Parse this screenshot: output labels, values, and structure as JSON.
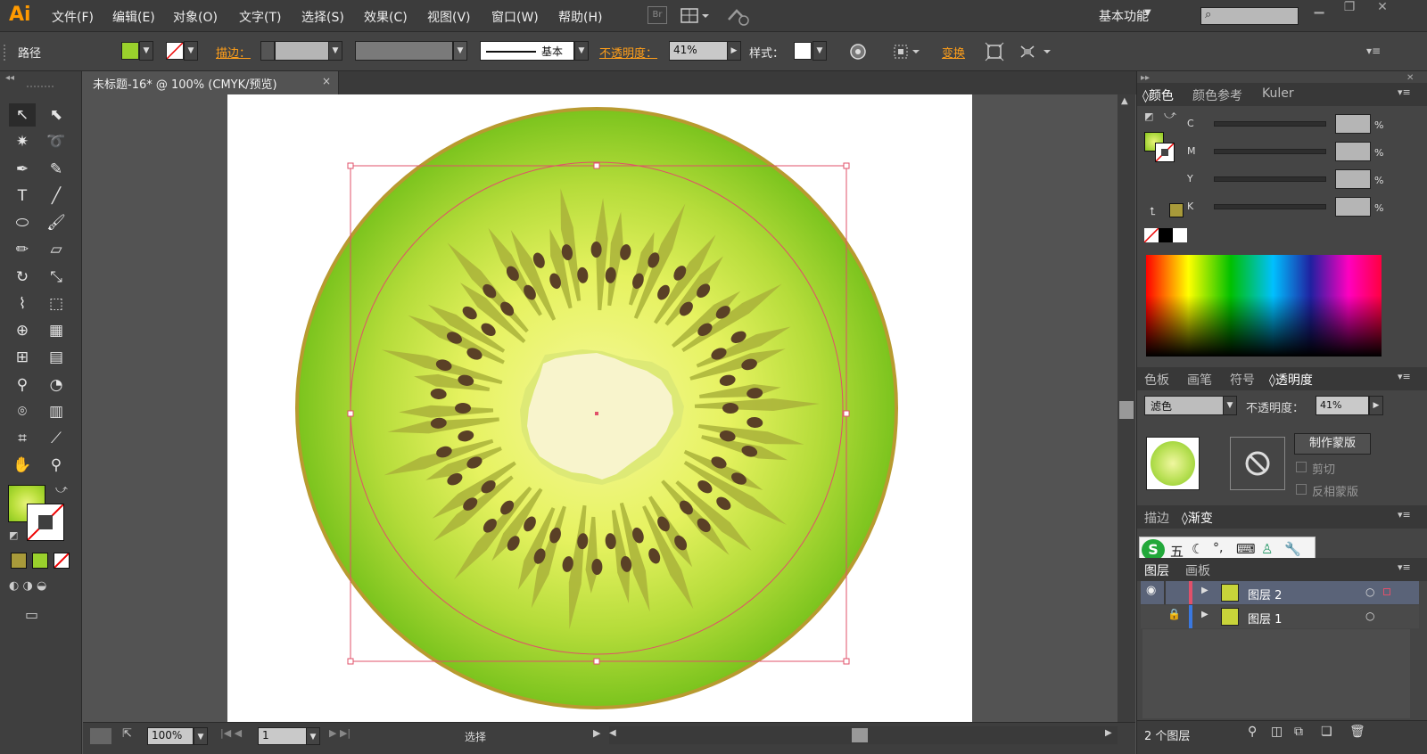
{
  "app": {
    "logo": "Ai",
    "bridge_label": "Br",
    "workspace": "基本功能",
    "accent": "#ff9a00"
  },
  "menu": [
    "文件(F)",
    "编辑(E)",
    "对象(O)",
    "文字(T)",
    "选择(S)",
    "效果(C)",
    "视图(V)",
    "窗口(W)",
    "帮助(H)"
  ],
  "control": {
    "selection_type": "路径",
    "stroke_label": "描边：",
    "stroke_style": "基本",
    "opacity_label": "不透明度：",
    "opacity_value": "41%",
    "style_label": "样式：",
    "transform_label": "变换"
  },
  "document": {
    "tab_title": "未标题-16* @ 100% (CMYK/预览)",
    "close_glyph": "×"
  },
  "status": {
    "zoom": "100%",
    "page": "1",
    "tool": "选择"
  },
  "color_panel": {
    "tabs": [
      "颜色",
      "颜色参考",
      "Kuler"
    ],
    "channels": [
      "C",
      "M",
      "Y",
      "K"
    ],
    "pct": "%"
  },
  "transparency_panel": {
    "tabs": [
      "色板",
      "画笔",
      "符号",
      "透明度"
    ],
    "blend_mode": "滤色",
    "opacity_label": "不透明度：",
    "opacity_value": "41%",
    "make_mask": "制作蒙版",
    "clip": "剪切",
    "invert_mask": "反相蒙版"
  },
  "gradient_panel": {
    "tabs": [
      "描边",
      "渐变"
    ]
  },
  "layers_panel": {
    "tabs": [
      "图层",
      "画板"
    ],
    "layers": [
      {
        "name": "图层 2"
      },
      {
        "name": "图层 1"
      }
    ],
    "count": "2 个图层"
  },
  "ime": {
    "logo": "S",
    "mode": "五"
  },
  "colors": {
    "kiwi_skin": "#b89a30",
    "kiwi_flesh_outer": "#7cc41e",
    "kiwi_flesh_inner": "#eaf56a",
    "core": "#f8f4cc",
    "seed": "#5a4026",
    "selection": "#e0506a"
  }
}
